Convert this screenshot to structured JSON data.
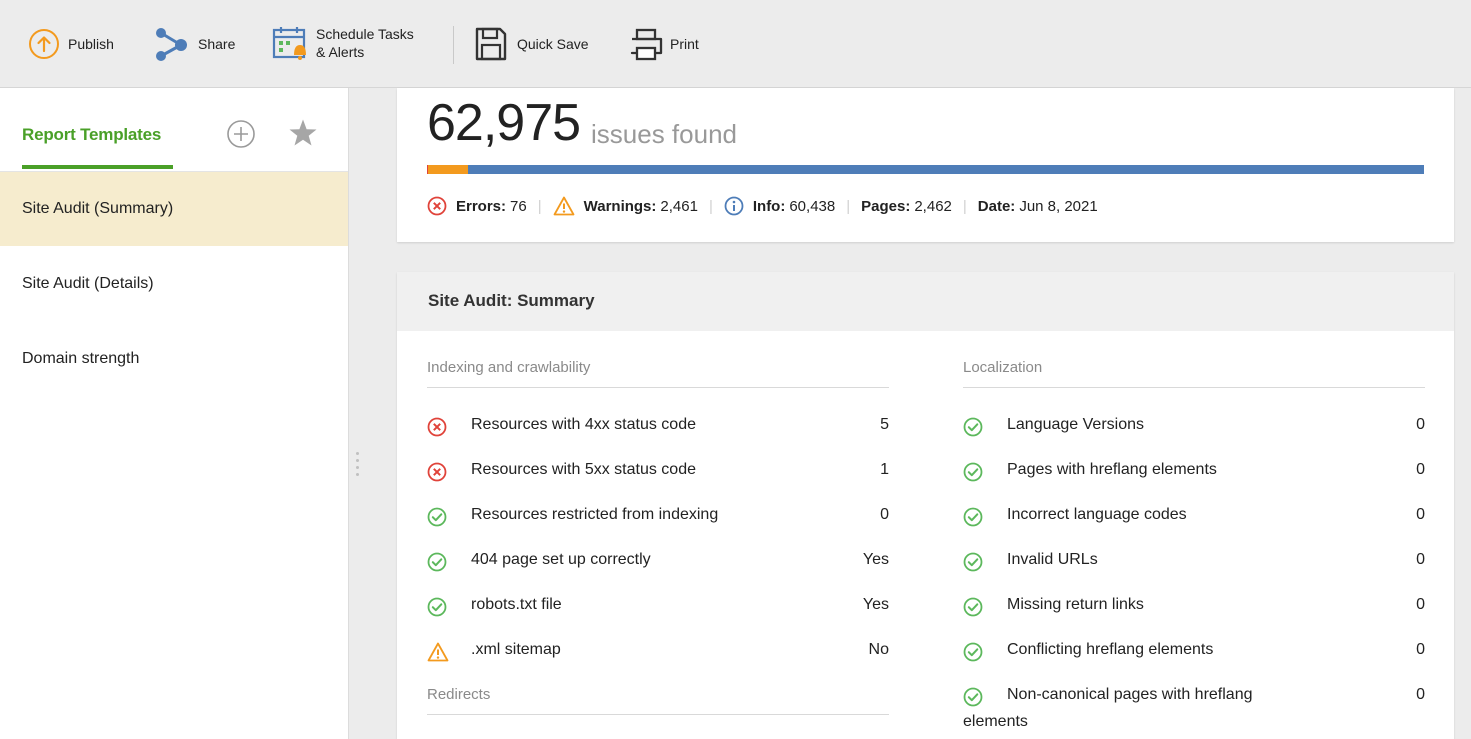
{
  "toolbar": {
    "publish": "Publish",
    "share": "Share",
    "schedule_line1": "Schedule Tasks",
    "schedule_line2": "& Alerts",
    "quick_save": "Quick Save",
    "print": "Print"
  },
  "sidebar": {
    "title": "Report Templates",
    "items": [
      {
        "label": "Site Audit (Summary)",
        "active": true
      },
      {
        "label": "Site Audit (Details)",
        "active": false
      },
      {
        "label": "Domain strength",
        "active": false
      }
    ]
  },
  "summary": {
    "count": "62,975",
    "count_label": "issues found",
    "errors_label": "Errors:",
    "errors_value": "76",
    "warnings_label": "Warnings:",
    "warnings_value": "2,461",
    "info_label": "Info:",
    "info_value": "60,438",
    "pages_label": "Pages:",
    "pages_value": "2,462",
    "date_label": "Date:",
    "date_value": "Jun 8, 2021",
    "bar_fractions": {
      "errors": 0.0012,
      "warnings": 0.0391,
      "info": 0.9597
    }
  },
  "audit": {
    "title": "Site Audit: Summary",
    "left": {
      "section1": "Indexing and crawlability",
      "rows": [
        {
          "status": "error",
          "label": "Resources with 4xx status code",
          "value": "5"
        },
        {
          "status": "error",
          "label": "Resources with 5xx status code",
          "value": "1"
        },
        {
          "status": "ok",
          "label": "Resources restricted from indexing",
          "value": "0"
        },
        {
          "status": "ok",
          "label": "404 page set up correctly",
          "value": "Yes"
        },
        {
          "status": "ok",
          "label": "robots.txt file",
          "value": "Yes"
        },
        {
          "status": "warning",
          "label": ".xml sitemap",
          "value": "No"
        }
      ],
      "section2": "Redirects"
    },
    "right": {
      "section1": "Localization",
      "rows": [
        {
          "status": "ok",
          "label": "Language Versions",
          "value": "0"
        },
        {
          "status": "ok",
          "label": "Pages with hreflang elements",
          "value": "0"
        },
        {
          "status": "ok",
          "label": "Incorrect language codes",
          "value": "0"
        },
        {
          "status": "ok",
          "label": "Invalid URLs",
          "value": "0"
        },
        {
          "status": "ok",
          "label": "Missing return links",
          "value": "0"
        },
        {
          "status": "ok",
          "label": "Conflicting hreflang elements",
          "value": "0"
        },
        {
          "status": "ok",
          "label": "Non-canonical pages with hreflang",
          "label2": "elements",
          "value": "0"
        }
      ]
    }
  },
  "colors": {
    "accent_green": "#4aa028",
    "error_red": "#e0433a",
    "warning_orange": "#f39a1e",
    "info_blue": "#4e7db8",
    "ok_green": "#5cb85c",
    "active_item": "#f6ecce"
  },
  "icons": {
    "publish": "upload-circle-icon",
    "share": "share-icon",
    "schedule": "calendar-bell-icon",
    "quick_save": "floppy-disk-icon",
    "print": "printer-icon",
    "add": "plus-circle-icon",
    "favorite": "star-icon"
  }
}
